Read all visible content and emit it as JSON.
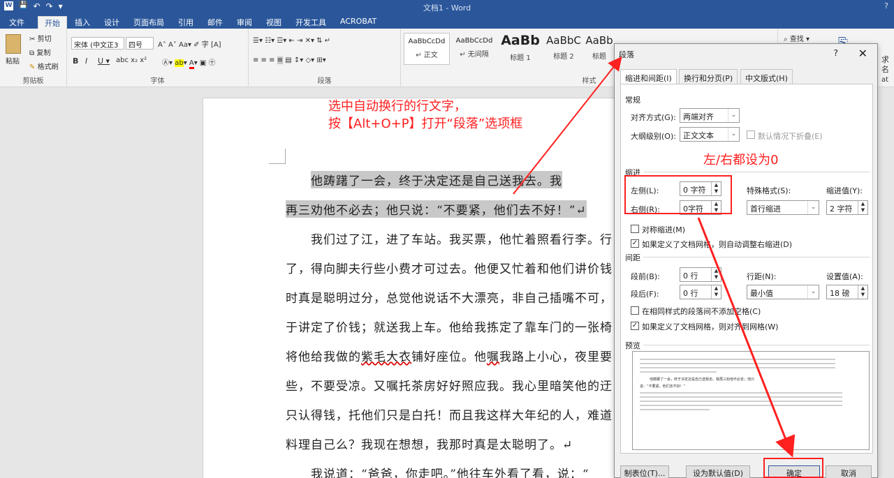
{
  "window": {
    "title": "文档1 - Word",
    "help": "?"
  },
  "quick_access": {
    "word_icon": "word-app-icon",
    "save": "💾",
    "undo": "↶",
    "redo": "↷",
    "more": "▾"
  },
  "tabs": [
    "文件",
    "开始",
    "插入",
    "设计",
    "页面布局",
    "引用",
    "邮件",
    "审阅",
    "视图",
    "开发工具",
    "ACROBAT"
  ],
  "ribbon": {
    "clipboard": {
      "paste": "粘贴",
      "cut": "剪切",
      "copy": "复制",
      "format_painter": "格式刷",
      "label": "剪贴板"
    },
    "font": {
      "font_name": "宋体 (中文正3",
      "font_size": "四号",
      "label": "字体"
    },
    "paragraph": {
      "label": "段落"
    },
    "styles": {
      "label": "样式",
      "items": [
        {
          "sample": "AaBbCcDd",
          "name": "↵ 正文"
        },
        {
          "sample": "AaBbCcDd",
          "name": "↵ 无间隔"
        },
        {
          "sample": "AaBb",
          "name": "标题 1"
        },
        {
          "sample": "AaBbC",
          "name": "标题 2"
        },
        {
          "sample": "AaBb",
          "name": "标题"
        }
      ]
    },
    "editing": {
      "find": "查找",
      "right_text_1": "求",
      "right_text_2": "名",
      "right_text_3": "at"
    }
  },
  "annotations": {
    "instruction_line1": "选中自动换行的行文字，",
    "instruction_line2": "按【Alt+O+P】打开“段落”选项框",
    "indent_note": "左/右都设为0"
  },
  "document": {
    "lines": [
      "他踌躇了一会，终于决定还是自己送我去。我",
      "再三劝他不必去；他只说：“不要紧，他们去不好！”↵",
      "我们过了江，进了车站。我买票，他忙着照看行李。行",
      "了，得向脚夫行些小费才可过去。他便又忙着和他们讲价钱",
      "时真是聪明过分，总觉他说话不大漂亮，非自己插嘴不可，",
      "于讲定了价钱；就送我上车。他给我拣定了靠车门的一张椅",
      "将他给我做的",
      "紫毛大衣",
      "铺好座位。他",
      "嘱",
      "我路上小心，夜里要",
      "些，不要受凉。又嘱托茶房好好照应我。我心里暗笑他的迂",
      "只认得钱，托他们只是白托！而且我这样大年纪的人，难道",
      "料理自己么？我现在想想，我那时真是太聪明了。↵",
      "我说道：“爸爸，你走吧。”他往车外看了看，说：“"
    ]
  },
  "dialog": {
    "title": "段落",
    "help": "?",
    "close": "✕",
    "tabs": [
      "缩进和间距(I)",
      "换行和分页(P)",
      "中文版式(H)"
    ],
    "general": {
      "section": "常规",
      "alignment_label": "对齐方式(G):",
      "alignment_value": "两端对齐",
      "outline_label": "大纲级别(O):",
      "outline_value": "正文文本",
      "collapse_label": "默认情况下折叠(E)"
    },
    "indent": {
      "section": "缩进",
      "left_label": "左侧(L):",
      "left_value": "0 字符",
      "right_label": "右侧(R):",
      "right_value": "0字符",
      "special_label": "特殊格式(S):",
      "special_value": "首行缩进",
      "by_label": "缩进值(Y):",
      "by_value": "2 字符",
      "mirror_label": "对称缩进(M)",
      "auto_adjust_label": "如果定义了文档网格，则自动调整右缩进(D)"
    },
    "spacing": {
      "section": "间距",
      "before_label": "段前(B):",
      "before_value": "0 行",
      "after_label": "段后(F):",
      "after_value": "0 行",
      "line_label": "行距(N):",
      "line_value": "最小值",
      "at_label": "设置值(A):",
      "at_value": "18 磅",
      "no_space_label": "在相同样式的段落间不添加空格(C)",
      "snap_label": "如果定义了文档网格，则对齐到网格(W)"
    },
    "preview": {
      "section": "预览",
      "sample_1": "他踌躇了一会，终于决定还是自己送我去。我再三劝他不必去；他只",
      "sample_2": "说：“不要紧，他们去不好！”"
    },
    "buttons": {
      "tabs": "制表位(T)...",
      "default": "设为默认值(D)",
      "ok": "确定",
      "cancel": "取消"
    }
  },
  "colors": {
    "accent": "#2b579a",
    "annotation": "#ff2020"
  }
}
